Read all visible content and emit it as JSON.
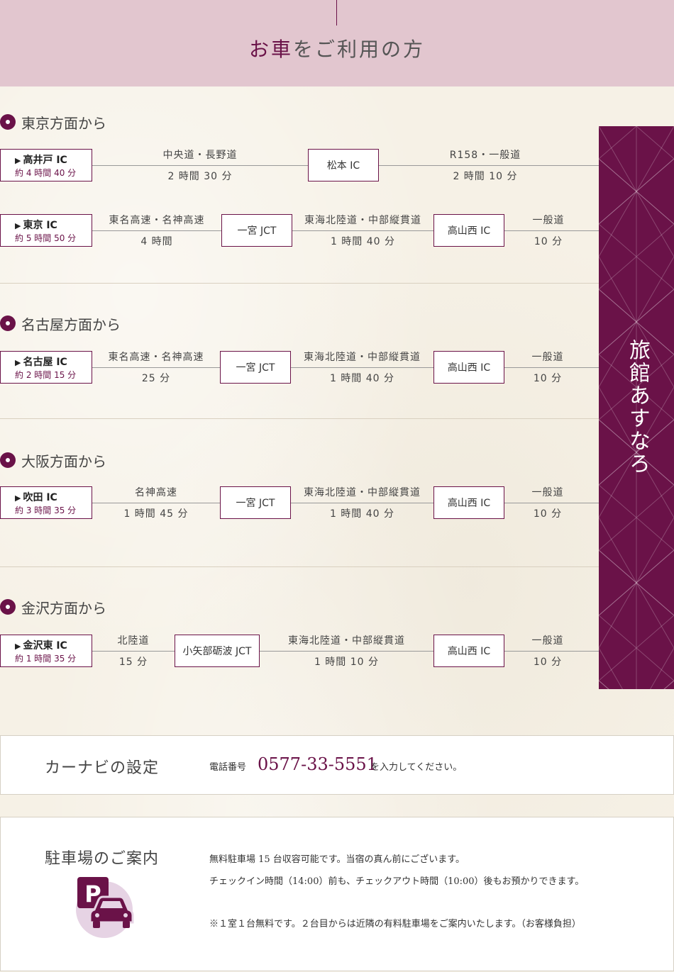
{
  "header": {
    "title_accent": "お車",
    "title_rest": "をご利用の方"
  },
  "side": {
    "title": "旅館あすなろ"
  },
  "sections": {
    "tokyo": {
      "title": "東京方面から",
      "r1": {
        "start": "高井戸 IC",
        "start_time": "約 4 時間 40 分",
        "seg1_road": "中央道・長野道",
        "seg1_time": "2 時間 30 分",
        "node1": "松本 IC",
        "seg2_road": "R158・一般道",
        "seg2_time": "2 時間 10 分"
      },
      "r2": {
        "start": "東京 IC",
        "start_time": "約 5 時間 50 分",
        "seg1_road": "東名高速・名神高速",
        "seg1_time": "4 時間",
        "node1": "一宮 JCT",
        "seg2_road": "東海北陸道・中部縦貫道",
        "seg2_time": "1 時間 40 分",
        "node2": "高山西 IC",
        "seg3_road": "一般道",
        "seg3_time": "10 分"
      }
    },
    "nagoya": {
      "title": "名古屋方面から",
      "r1": {
        "start": "名古屋 IC",
        "start_time": "約 2 時間 15 分",
        "seg1_road": "東名高速・名神高速",
        "seg1_time": "25 分",
        "node1": "一宮 JCT",
        "seg2_road": "東海北陸道・中部縦貫道",
        "seg2_time": "1 時間 40 分",
        "node2": "高山西 IC",
        "seg3_road": "一般道",
        "seg3_time": "10 分"
      }
    },
    "osaka": {
      "title": "大阪方面から",
      "r1": {
        "start": "吹田 IC",
        "start_time": "約 3 時間 35 分",
        "seg1_road": "名神高速",
        "seg1_time": "1 時間 45 分",
        "node1": "一宮 JCT",
        "seg2_road": "東海北陸道・中部縦貫道",
        "seg2_time": "1 時間 40 分",
        "node2": "高山西 IC",
        "seg3_road": "一般道",
        "seg3_time": "10 分"
      }
    },
    "kanazawa": {
      "title": "金沢方面から",
      "r1": {
        "start": "金沢東 IC",
        "start_time": "約 1 時間 35 分",
        "seg1_road": "北陸道",
        "seg1_time": "15 分",
        "node1": "小矢部砺波 JCT",
        "seg2_road": "東海北陸道・中部縦貫道",
        "seg2_time": "1 時間 10 分",
        "node2": "高山西 IC",
        "seg3_road": "一般道",
        "seg3_time": "10 分"
      }
    }
  },
  "navi": {
    "title": "カーナビの設定",
    "label": "電話番号",
    "phone": "0577-33-5551",
    "after": "を入力してください。"
  },
  "parking": {
    "title": "駐車場のご案内",
    "line1": "無料駐車場 15 台収容可能です。当宿の真ん前にございます。",
    "line2": "チェックイン時間（14:00）前も、チェックアウト時間（10:00）後もお預かりできます。",
    "line3": "※１室１台無料です。２台目からは近隣の有料駐車場をご案内いたします。（お客様負担）",
    "icon_letter": "P"
  },
  "colors": {
    "accent": "#6a1248",
    "header_bg": "#e2c6cf",
    "page_bg": "#f6f1e6"
  }
}
